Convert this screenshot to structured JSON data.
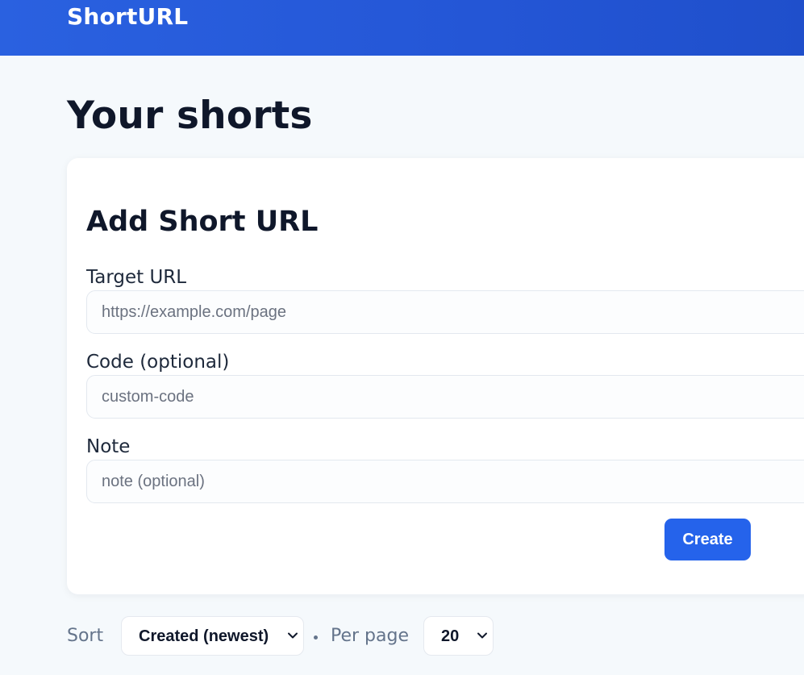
{
  "header": {
    "brand": "ShortURL"
  },
  "page": {
    "title": "Your shorts"
  },
  "form": {
    "title": "Add Short URL",
    "target_url": {
      "label": "Target URL",
      "placeholder": "https://example.com/page",
      "value": ""
    },
    "code": {
      "label": "Code (optional)",
      "placeholder": "custom-code",
      "value": ""
    },
    "note": {
      "label": "Note",
      "placeholder": "note (optional)",
      "value": ""
    },
    "submit_label": "Create"
  },
  "list_controls": {
    "sort_label": "Sort",
    "sort_selected": "Created (newest)",
    "per_page_label": "Per page",
    "per_page_selected": "20"
  },
  "colors": {
    "header_bg": "#2456d6",
    "accent": "#2563eb",
    "page_bg": "#f5f9fc"
  },
  "icons": {
    "select_caret": "chevron-down-icon"
  }
}
